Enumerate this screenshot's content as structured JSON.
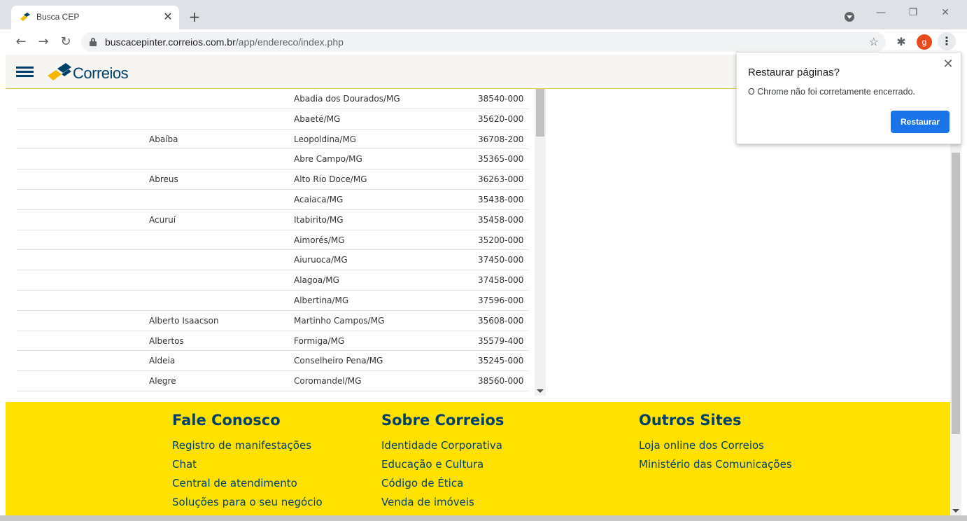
{
  "browser": {
    "tab_title": "Busca CEP",
    "tab_close": "✕",
    "new_tab": "+",
    "url_host": "buscacepinter.correios.com.br",
    "url_path": "/app/endereco/index.php",
    "profile_initial": "g"
  },
  "site": {
    "logo_text": "Correios"
  },
  "results": [
    {
      "bairro": "",
      "cidade": "Abadia dos Dourados/MG",
      "cep": "38540-000"
    },
    {
      "bairro": "",
      "cidade": "Abaeté/MG",
      "cep": "35620-000"
    },
    {
      "bairro": "Abaíba",
      "cidade": "Leopoldina/MG",
      "cep": "36708-200"
    },
    {
      "bairro": "",
      "cidade": "Abre Campo/MG",
      "cep": "35365-000"
    },
    {
      "bairro": "Abreus",
      "cidade": "Alto Rio Doce/MG",
      "cep": "36263-000"
    },
    {
      "bairro": "",
      "cidade": "Acaiaca/MG",
      "cep": "35438-000"
    },
    {
      "bairro": "Acuruí",
      "cidade": "Itabirito/MG",
      "cep": "35458-000"
    },
    {
      "bairro": "",
      "cidade": "Aimorés/MG",
      "cep": "35200-000"
    },
    {
      "bairro": "",
      "cidade": "Aiuruoca/MG",
      "cep": "37450-000"
    },
    {
      "bairro": "",
      "cidade": "Alagoa/MG",
      "cep": "37458-000"
    },
    {
      "bairro": "",
      "cidade": "Albertina/MG",
      "cep": "37596-000"
    },
    {
      "bairro": "Alberto Isaacson",
      "cidade": "Martinho Campos/MG",
      "cep": "35608-000"
    },
    {
      "bairro": "Albertos",
      "cidade": "Formiga/MG",
      "cep": "35579-400"
    },
    {
      "bairro": "Aldeia",
      "cidade": "Conselheiro Pena/MG",
      "cep": "35245-000"
    },
    {
      "bairro": "Alegre",
      "cidade": "Coromandel/MG",
      "cep": "38560-000"
    }
  ],
  "footer": {
    "fale_conosco": {
      "title": "Fale Conosco",
      "links": [
        "Registro de manifestações",
        "Chat",
        "Central de atendimento",
        "Soluções para o seu negócio"
      ]
    },
    "sobre_correios": {
      "title": "Sobre Correios",
      "links": [
        "Identidade Corporativa",
        "Educação e Cultura",
        "Código de Ética",
        "Venda de imóveis"
      ]
    },
    "outros_sites": {
      "title": "Outros Sites",
      "links": [
        "Loja online dos Correios",
        "Ministério das Comunicações"
      ]
    }
  },
  "popup": {
    "title": "Restaurar páginas?",
    "message": "O Chrome não foi corretamente encerrado.",
    "button": "Restaurar"
  },
  "colors": {
    "brand_blue": "#00416b",
    "brand_yellow": "#ffe100",
    "chrome_button_blue": "#1a73e8"
  }
}
